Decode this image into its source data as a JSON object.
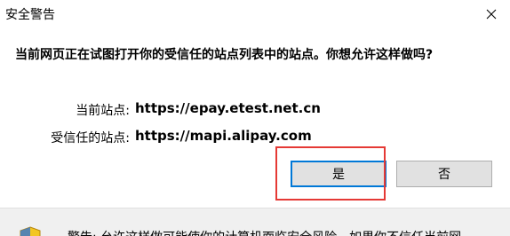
{
  "window": {
    "title": "安全警告",
    "close_label": "×"
  },
  "message": "当前网页正在试图打开你的受信任的站点列表中的站点。你想允许这样做吗?",
  "info": {
    "current_site_label": "当前站点:",
    "current_site_value": "https://epay.etest.net.cn",
    "trusted_site_label": "受信任的站点:",
    "trusted_site_value": "https://mapi.alipay.com"
  },
  "buttons": {
    "yes_label": "是",
    "no_label": "否"
  },
  "footer": {
    "warning_text": "警告: 允许这样做可能使你的计算机面临安全风险。如果你不信任当前网",
    "icon": "warning-shield-icon"
  },
  "colors": {
    "highlight": "#e53935",
    "button_face": "#e1e1e1",
    "focus_border": "#0078d7",
    "footer_bg": "#f0f0f0"
  }
}
